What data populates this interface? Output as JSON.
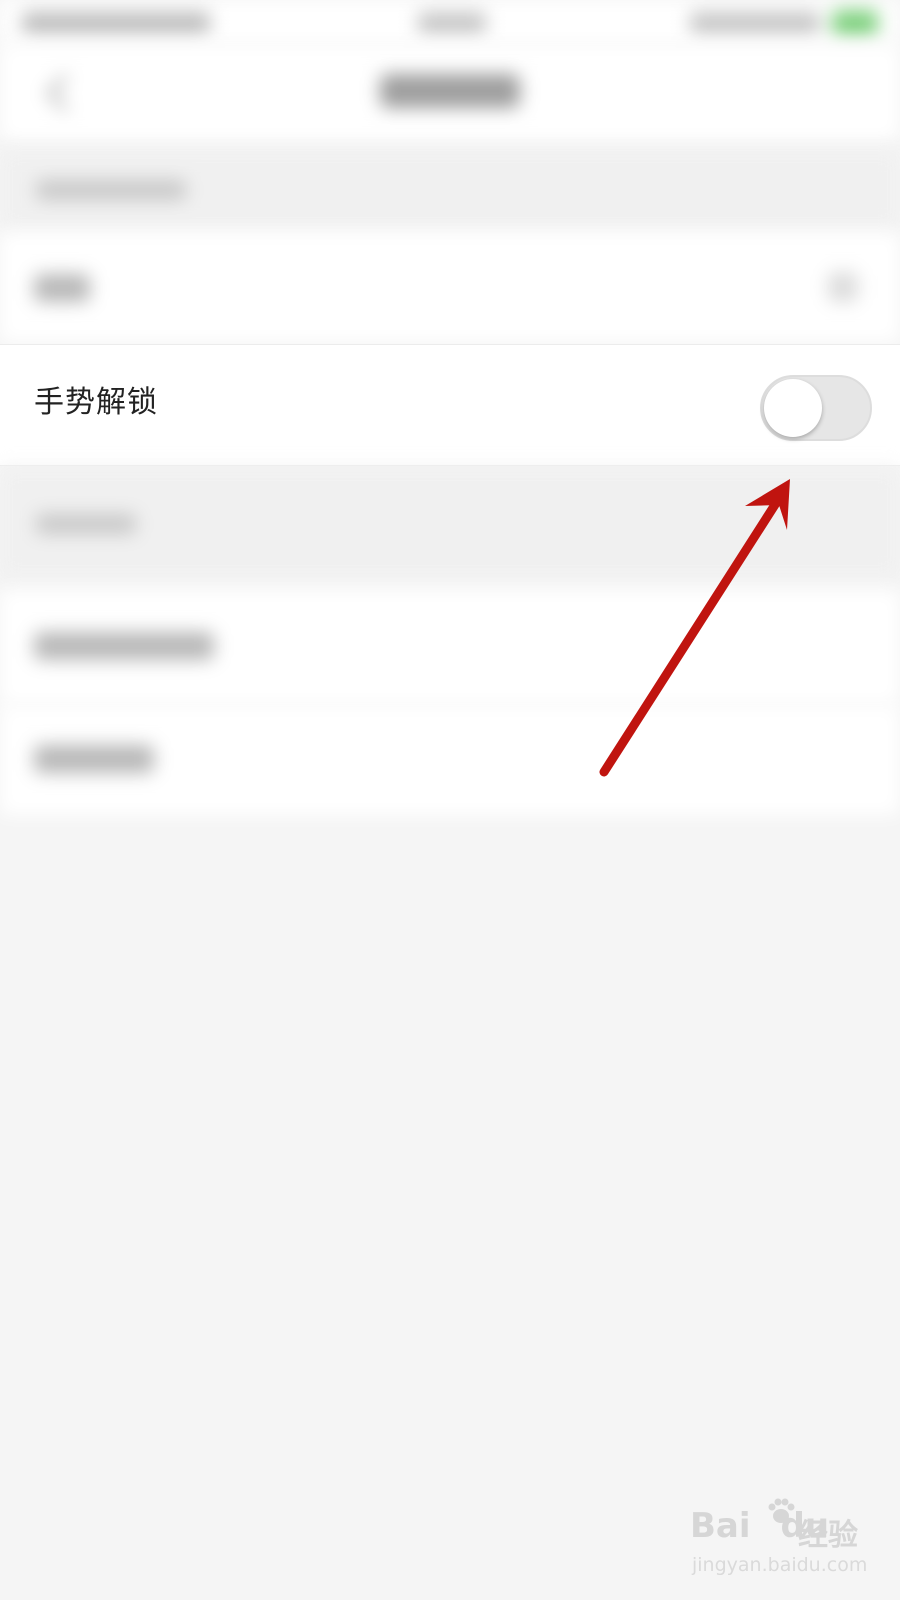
{
  "gesture_unlock": {
    "label": "手势解锁",
    "toggle_state": "off"
  },
  "annotation": {
    "arrow_color": "#c0140f"
  },
  "watermark": {
    "logo": "Bai",
    "logo_suffix": "du",
    "brand": "经验",
    "url": "jingyan.baidu.com"
  },
  "icons": [
    "back-arrow-icon",
    "paw-logo-icon",
    "red-arrow-icon"
  ]
}
